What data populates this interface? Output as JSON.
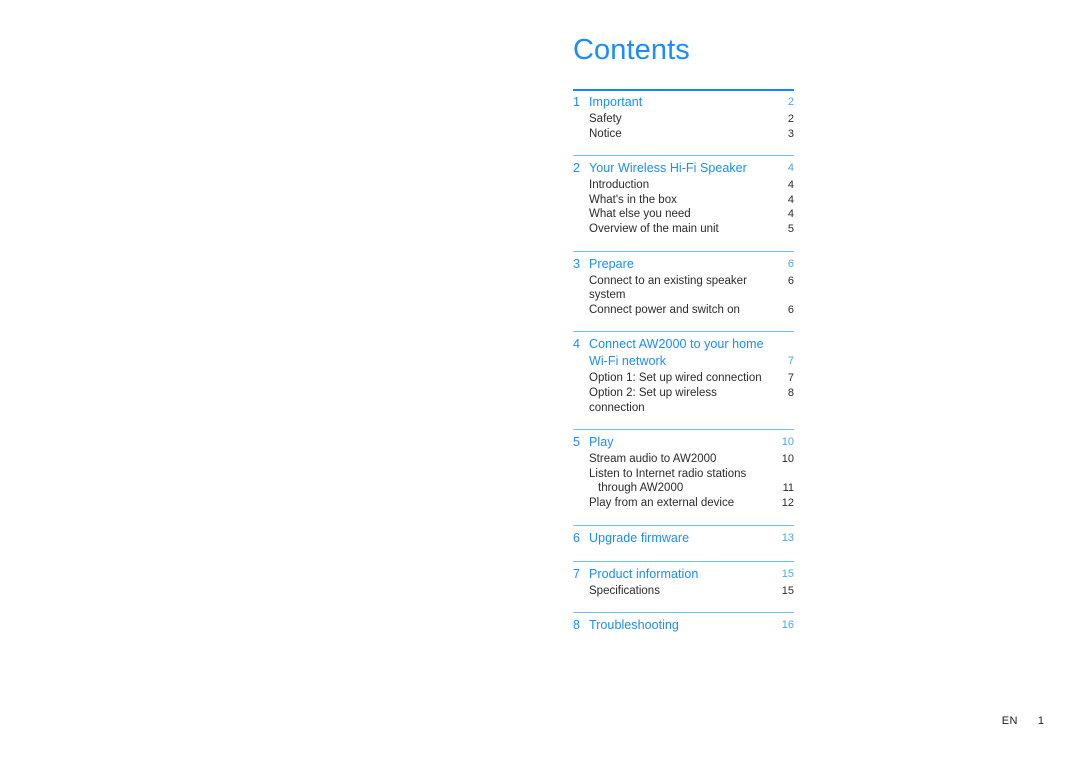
{
  "document": {
    "title": "Contents",
    "language_code": "EN",
    "page_number": "1"
  },
  "toc": {
    "chapters": [
      {
        "number": "1",
        "title": "Important",
        "page": "2",
        "rule": "strong",
        "entries": [
          {
            "label": "Safety",
            "page": "2"
          },
          {
            "label": "Notice",
            "page": "3"
          }
        ]
      },
      {
        "number": "2",
        "title": "Your Wireless Hi-Fi Speaker",
        "page": "4",
        "rule": "light",
        "entries": [
          {
            "label": "Introduction",
            "page": "4"
          },
          {
            "label": "What's in the box",
            "page": "4"
          },
          {
            "label": "What else you need",
            "page": "4"
          },
          {
            "label": "Overview of the main unit",
            "page": "5"
          }
        ]
      },
      {
        "number": "3",
        "title": "Prepare",
        "page": "6",
        "rule": "light",
        "entries": [
          {
            "label": "Connect to an existing speaker system",
            "page": "6"
          },
          {
            "label": "Connect power and switch on",
            "page": "6"
          }
        ]
      },
      {
        "number": "4",
        "title": "Connect AW2000 to your home",
        "title_line2": "Wi-Fi network",
        "page": "7",
        "rule": "light",
        "entries": [
          {
            "label": "Option 1: Set up wired connection",
            "page": "7"
          },
          {
            "label": "Option 2: Set up wireless connection",
            "page": "8"
          }
        ]
      },
      {
        "number": "5",
        "title": "Play",
        "page": "10",
        "rule": "light",
        "entries": [
          {
            "label": "Stream audio to AW2000",
            "page": "10"
          },
          {
            "label": "Listen to Internet radio stations",
            "page": ""
          },
          {
            "label": "through AW2000",
            "page": "11",
            "continuation": true
          },
          {
            "label": "Play from an external device",
            "page": "12"
          }
        ]
      },
      {
        "number": "6",
        "title": "Upgrade firmware",
        "page": "13",
        "rule": "light",
        "entries": []
      },
      {
        "number": "7",
        "title": "Product information",
        "page": "15",
        "rule": "light",
        "entries": [
          {
            "label": "Specifications",
            "page": "15"
          }
        ]
      },
      {
        "number": "8",
        "title": "Troubleshooting",
        "page": "16",
        "rule": "light",
        "entries": []
      }
    ]
  },
  "colors": {
    "heading_blue": "#1a8cff",
    "page_blue": "#4aa8f0",
    "rule_strong": "#0d87ff",
    "rule_light": "#6ec0f5",
    "body_text": "#2b2b2b"
  }
}
